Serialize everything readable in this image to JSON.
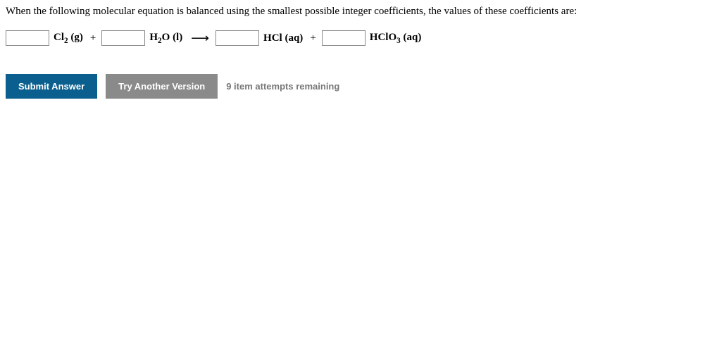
{
  "question": "When the following molecular equation is balanced using the smallest possible integer coefficients, the values of these coefficients are:",
  "equation": {
    "term1": {
      "formula_prefix": "Cl",
      "sub": "2",
      "state": " (g)"
    },
    "plus1": "+",
    "term2": {
      "formula_prefix": "H",
      "sub": "2",
      "formula_suffix": "O",
      "state": " (l)"
    },
    "arrow": "⟶",
    "term3": {
      "formula_prefix": "HCl",
      "state": " (aq)"
    },
    "plus2": "+",
    "term4": {
      "formula_prefix": "HClO",
      "sub": "3",
      "state": " (aq)"
    }
  },
  "buttons": {
    "submit": "Submit Answer",
    "another": "Try Another Version"
  },
  "attempts": "9 item attempts remaining"
}
